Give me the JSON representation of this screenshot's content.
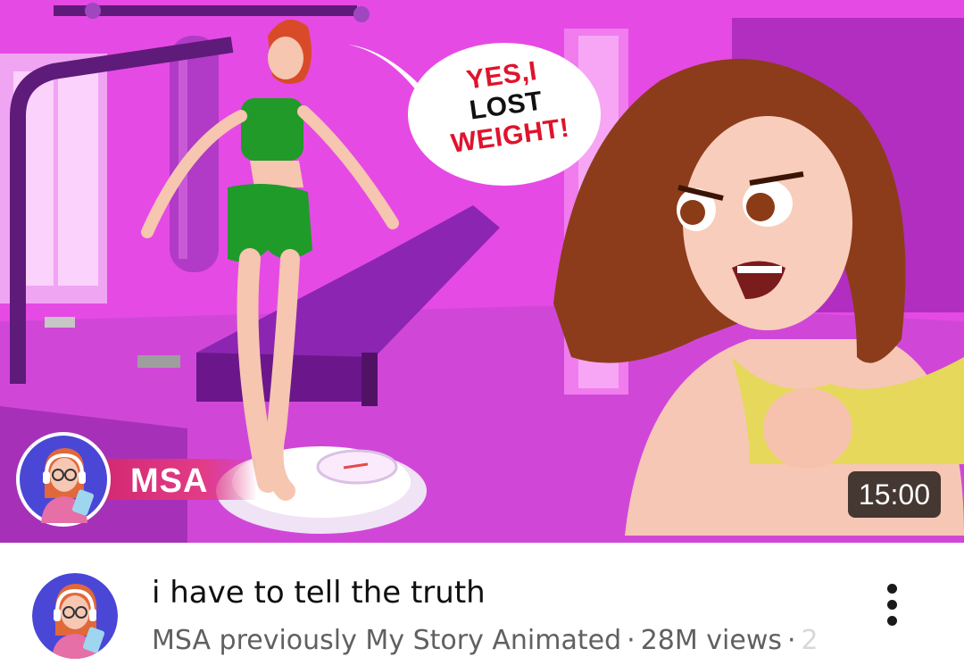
{
  "thumbnail": {
    "speech_bubble": {
      "line1": "YES,I",
      "line2": "LOST",
      "line3": "WEIGHT!"
    },
    "brand_tag": "MSA",
    "duration": "15:00"
  },
  "video": {
    "title": "i have to tell the truth",
    "channel": "MSA previously My Story Animated",
    "views": "28M views",
    "separator": "·",
    "truncated_tail": "2"
  },
  "icons": {
    "more": "more-vert-icon",
    "channel_avatar": "avatar-icon"
  },
  "colors": {
    "thumbnail_bg": "#e84ce6",
    "brand_red": "#d0246e",
    "text_primary": "#0f0f0f",
    "text_secondary": "#606060"
  }
}
